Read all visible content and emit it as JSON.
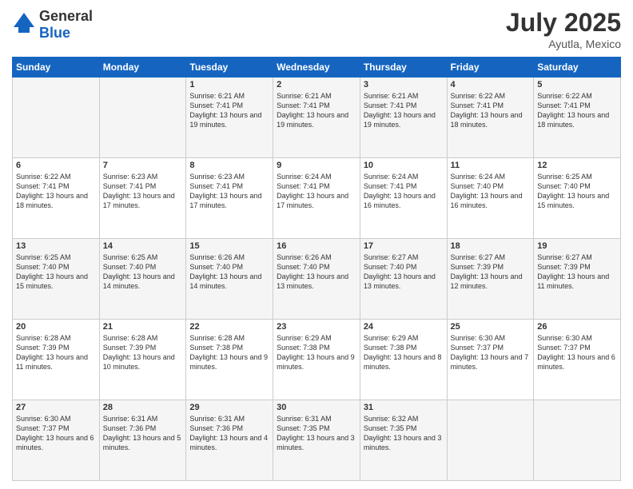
{
  "header": {
    "logo": {
      "general": "General",
      "blue": "Blue"
    },
    "title": "July 2025",
    "subtitle": "Ayutla, Mexico"
  },
  "calendar": {
    "days": [
      "Sunday",
      "Monday",
      "Tuesday",
      "Wednesday",
      "Thursday",
      "Friday",
      "Saturday"
    ],
    "weeks": [
      [
        {
          "day": null,
          "sunrise": null,
          "sunset": null,
          "daylight": null
        },
        {
          "day": null,
          "sunrise": null,
          "sunset": null,
          "daylight": null
        },
        {
          "day": "1",
          "sunrise": "Sunrise: 6:21 AM",
          "sunset": "Sunset: 7:41 PM",
          "daylight": "Daylight: 13 hours and 19 minutes."
        },
        {
          "day": "2",
          "sunrise": "Sunrise: 6:21 AM",
          "sunset": "Sunset: 7:41 PM",
          "daylight": "Daylight: 13 hours and 19 minutes."
        },
        {
          "day": "3",
          "sunrise": "Sunrise: 6:21 AM",
          "sunset": "Sunset: 7:41 PM",
          "daylight": "Daylight: 13 hours and 19 minutes."
        },
        {
          "day": "4",
          "sunrise": "Sunrise: 6:22 AM",
          "sunset": "Sunset: 7:41 PM",
          "daylight": "Daylight: 13 hours and 18 minutes."
        },
        {
          "day": "5",
          "sunrise": "Sunrise: 6:22 AM",
          "sunset": "Sunset: 7:41 PM",
          "daylight": "Daylight: 13 hours and 18 minutes."
        }
      ],
      [
        {
          "day": "6",
          "sunrise": "Sunrise: 6:22 AM",
          "sunset": "Sunset: 7:41 PM",
          "daylight": "Daylight: 13 hours and 18 minutes."
        },
        {
          "day": "7",
          "sunrise": "Sunrise: 6:23 AM",
          "sunset": "Sunset: 7:41 PM",
          "daylight": "Daylight: 13 hours and 17 minutes."
        },
        {
          "day": "8",
          "sunrise": "Sunrise: 6:23 AM",
          "sunset": "Sunset: 7:41 PM",
          "daylight": "Daylight: 13 hours and 17 minutes."
        },
        {
          "day": "9",
          "sunrise": "Sunrise: 6:24 AM",
          "sunset": "Sunset: 7:41 PM",
          "daylight": "Daylight: 13 hours and 17 minutes."
        },
        {
          "day": "10",
          "sunrise": "Sunrise: 6:24 AM",
          "sunset": "Sunset: 7:41 PM",
          "daylight": "Daylight: 13 hours and 16 minutes."
        },
        {
          "day": "11",
          "sunrise": "Sunrise: 6:24 AM",
          "sunset": "Sunset: 7:40 PM",
          "daylight": "Daylight: 13 hours and 16 minutes."
        },
        {
          "day": "12",
          "sunrise": "Sunrise: 6:25 AM",
          "sunset": "Sunset: 7:40 PM",
          "daylight": "Daylight: 13 hours and 15 minutes."
        }
      ],
      [
        {
          "day": "13",
          "sunrise": "Sunrise: 6:25 AM",
          "sunset": "Sunset: 7:40 PM",
          "daylight": "Daylight: 13 hours and 15 minutes."
        },
        {
          "day": "14",
          "sunrise": "Sunrise: 6:25 AM",
          "sunset": "Sunset: 7:40 PM",
          "daylight": "Daylight: 13 hours and 14 minutes."
        },
        {
          "day": "15",
          "sunrise": "Sunrise: 6:26 AM",
          "sunset": "Sunset: 7:40 PM",
          "daylight": "Daylight: 13 hours and 14 minutes."
        },
        {
          "day": "16",
          "sunrise": "Sunrise: 6:26 AM",
          "sunset": "Sunset: 7:40 PM",
          "daylight": "Daylight: 13 hours and 13 minutes."
        },
        {
          "day": "17",
          "sunrise": "Sunrise: 6:27 AM",
          "sunset": "Sunset: 7:40 PM",
          "daylight": "Daylight: 13 hours and 13 minutes."
        },
        {
          "day": "18",
          "sunrise": "Sunrise: 6:27 AM",
          "sunset": "Sunset: 7:39 PM",
          "daylight": "Daylight: 13 hours and 12 minutes."
        },
        {
          "day": "19",
          "sunrise": "Sunrise: 6:27 AM",
          "sunset": "Sunset: 7:39 PM",
          "daylight": "Daylight: 13 hours and 11 minutes."
        }
      ],
      [
        {
          "day": "20",
          "sunrise": "Sunrise: 6:28 AM",
          "sunset": "Sunset: 7:39 PM",
          "daylight": "Daylight: 13 hours and 11 minutes."
        },
        {
          "day": "21",
          "sunrise": "Sunrise: 6:28 AM",
          "sunset": "Sunset: 7:39 PM",
          "daylight": "Daylight: 13 hours and 10 minutes."
        },
        {
          "day": "22",
          "sunrise": "Sunrise: 6:28 AM",
          "sunset": "Sunset: 7:38 PM",
          "daylight": "Daylight: 13 hours and 9 minutes."
        },
        {
          "day": "23",
          "sunrise": "Sunrise: 6:29 AM",
          "sunset": "Sunset: 7:38 PM",
          "daylight": "Daylight: 13 hours and 9 minutes."
        },
        {
          "day": "24",
          "sunrise": "Sunrise: 6:29 AM",
          "sunset": "Sunset: 7:38 PM",
          "daylight": "Daylight: 13 hours and 8 minutes."
        },
        {
          "day": "25",
          "sunrise": "Sunrise: 6:30 AM",
          "sunset": "Sunset: 7:37 PM",
          "daylight": "Daylight: 13 hours and 7 minutes."
        },
        {
          "day": "26",
          "sunrise": "Sunrise: 6:30 AM",
          "sunset": "Sunset: 7:37 PM",
          "daylight": "Daylight: 13 hours and 6 minutes."
        }
      ],
      [
        {
          "day": "27",
          "sunrise": "Sunrise: 6:30 AM",
          "sunset": "Sunset: 7:37 PM",
          "daylight": "Daylight: 13 hours and 6 minutes."
        },
        {
          "day": "28",
          "sunrise": "Sunrise: 6:31 AM",
          "sunset": "Sunset: 7:36 PM",
          "daylight": "Daylight: 13 hours and 5 minutes."
        },
        {
          "day": "29",
          "sunrise": "Sunrise: 6:31 AM",
          "sunset": "Sunset: 7:36 PM",
          "daylight": "Daylight: 13 hours and 4 minutes."
        },
        {
          "day": "30",
          "sunrise": "Sunrise: 6:31 AM",
          "sunset": "Sunset: 7:35 PM",
          "daylight": "Daylight: 13 hours and 3 minutes."
        },
        {
          "day": "31",
          "sunrise": "Sunrise: 6:32 AM",
          "sunset": "Sunset: 7:35 PM",
          "daylight": "Daylight: 13 hours and 3 minutes."
        },
        {
          "day": null,
          "sunrise": null,
          "sunset": null,
          "daylight": null
        },
        {
          "day": null,
          "sunrise": null,
          "sunset": null,
          "daylight": null
        }
      ]
    ]
  }
}
